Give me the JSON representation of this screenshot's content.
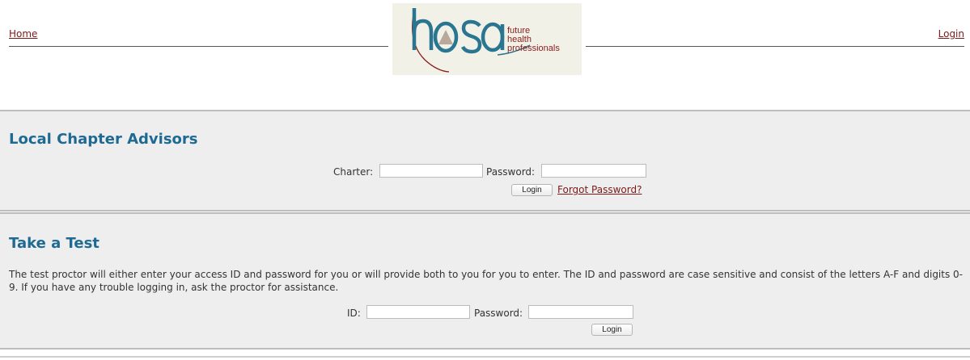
{
  "header": {
    "home_link": "Home",
    "login_link": "Login",
    "logo": {
      "wordmark": "hosa",
      "tagline_lines": [
        "future",
        "health",
        "professionals"
      ]
    }
  },
  "advisors": {
    "title": "Local Chapter Advisors",
    "charter_label": "Charter:",
    "charter_value": "",
    "password_label": "Password:",
    "password_value": "",
    "login_button": "Login",
    "forgot_link": "Forgot Password?"
  },
  "test": {
    "title": "Take a Test",
    "description": "The test proctor will either enter your access ID and password for you or will provide both to you for you to enter. The ID and password are case sensitive and consist of the letters A-F and digits 0-9. If you have any trouble logging in, ask the proctor for assistance.",
    "id_label": "ID:",
    "id_value": "",
    "password_label": "Password:",
    "password_value": "",
    "login_button": "Login"
  },
  "colors": {
    "link": "#7a1a1a",
    "heading": "#1f6a93",
    "section_bg": "#eeeeee",
    "logo_teal": "#2a7590",
    "logo_red": "#8a1c1c",
    "logo_triangle": "#b9a99a"
  }
}
